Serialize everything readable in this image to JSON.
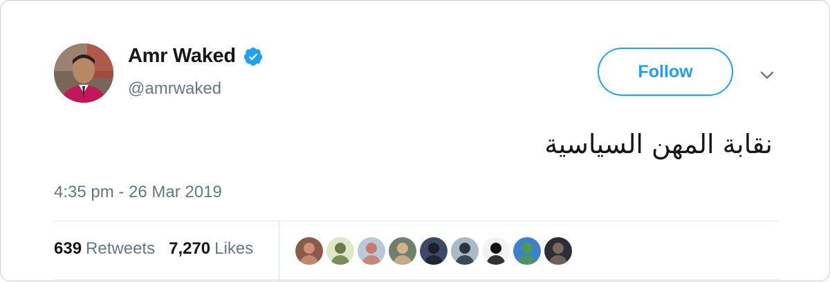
{
  "user": {
    "display_name": "Amr Waked",
    "handle": "@amrwaked",
    "verified_icon": "verified-badge-icon",
    "verified_color": "#1da1f2"
  },
  "actions": {
    "follow_label": "Follow",
    "more_icon": "chevron-down-icon"
  },
  "tweet": {
    "text": "نقابة المهن السياسية",
    "timestamp": "4:35 pm - 26 Mar 2019"
  },
  "stats": {
    "retweets_count": "639",
    "retweets_label": "Retweets",
    "likes_count": "7,270",
    "likes_label": "Likes"
  },
  "likers": [
    {
      "icon": "user-avatar-1",
      "bg": "#8a5a4a",
      "fg": "#c99274"
    },
    {
      "icon": "user-avatar-2",
      "bg": "#dfe7c4",
      "fg": "#6d7b4a"
    },
    {
      "icon": "user-avatar-3",
      "bg": "#b8c9d9",
      "fg": "#c97a6a"
    },
    {
      "icon": "user-avatar-4",
      "bg": "#6e7f6a",
      "fg": "#d8b08c"
    },
    {
      "icon": "user-avatar-5",
      "bg": "#3a4a66",
      "fg": "#1a1f2a"
    },
    {
      "icon": "user-avatar-6",
      "bg": "#a9b9c8",
      "fg": "#2b3440"
    },
    {
      "icon": "user-avatar-7",
      "bg": "#f2f2f2",
      "fg": "#111111"
    },
    {
      "icon": "user-avatar-8",
      "bg": "#3f7fd0",
      "fg": "#4e9a4a"
    },
    {
      "icon": "user-avatar-9",
      "bg": "#2c2f36",
      "fg": "#7a6a5e"
    }
  ],
  "colors": {
    "accent": "#1da1f2",
    "secondary_text": "#657786",
    "primary_text": "#14171a",
    "border": "#e1e8ed"
  }
}
